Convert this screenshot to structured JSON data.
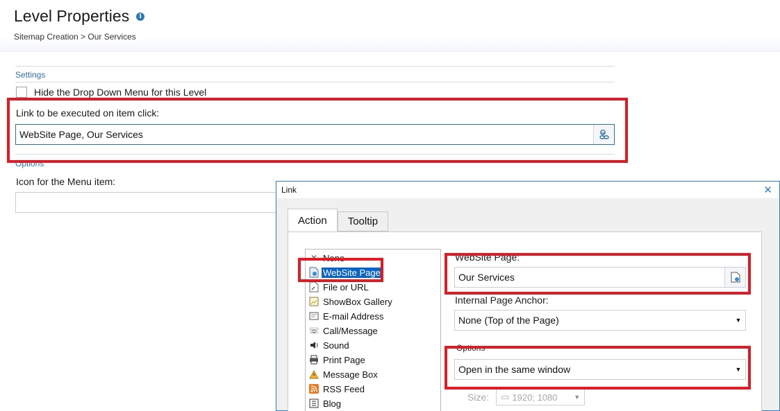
{
  "header": {
    "title": "Level Properties",
    "info_icon": "info-icon",
    "breadcrumb": "Sitemap Creation > Our Services"
  },
  "settings": {
    "section_label": "Settings",
    "hide_dropdown_label": "Hide the Drop Down Menu for this Level",
    "hide_dropdown_checked": false,
    "link_label": "Link to be executed on item click:",
    "link_value": "WebSite Page, Our Services",
    "link_button_icon": "link-icon"
  },
  "options": {
    "section_label": "Options",
    "icon_label": "Icon for the Menu item:",
    "icon_value": ""
  },
  "dialog": {
    "title": "Link",
    "close_icon": "close-icon",
    "tabs": [
      {
        "label": "Action",
        "active": true
      },
      {
        "label": "Tooltip",
        "active": false
      }
    ],
    "actions": [
      {
        "label": "None",
        "icon": "none-icon",
        "selected": false
      },
      {
        "label": "WebSite Page",
        "icon": "website-page-icon",
        "selected": true
      },
      {
        "label": "File or URL",
        "icon": "file-url-icon",
        "selected": false
      },
      {
        "label": "ShowBox Gallery",
        "icon": "gallery-icon",
        "selected": false
      },
      {
        "label": "E-mail Address",
        "icon": "email-icon",
        "selected": false
      },
      {
        "label": "Call/Message",
        "icon": "phone-icon",
        "selected": false
      },
      {
        "label": "Sound",
        "icon": "sound-icon",
        "selected": false
      },
      {
        "label": "Print Page",
        "icon": "print-icon",
        "selected": false
      },
      {
        "label": "Message Box",
        "icon": "warning-icon",
        "selected": false
      },
      {
        "label": "RSS Feed",
        "icon": "rss-icon",
        "selected": false
      },
      {
        "label": "Blog",
        "icon": "blog-icon",
        "selected": false
      }
    ],
    "website_page_label": "WebSite Page:",
    "website_page_value": "Our Services",
    "anchor_label": "Internal Page Anchor:",
    "anchor_value": "None (Top of the Page)",
    "options_label": "Options",
    "options_value": "Open in the same window",
    "size_label": "Size:",
    "size_value": "1920; 1080"
  },
  "colors": {
    "accent": "#2e6fb0",
    "highlight": "#e01b24",
    "selected": "#0a64c8"
  }
}
